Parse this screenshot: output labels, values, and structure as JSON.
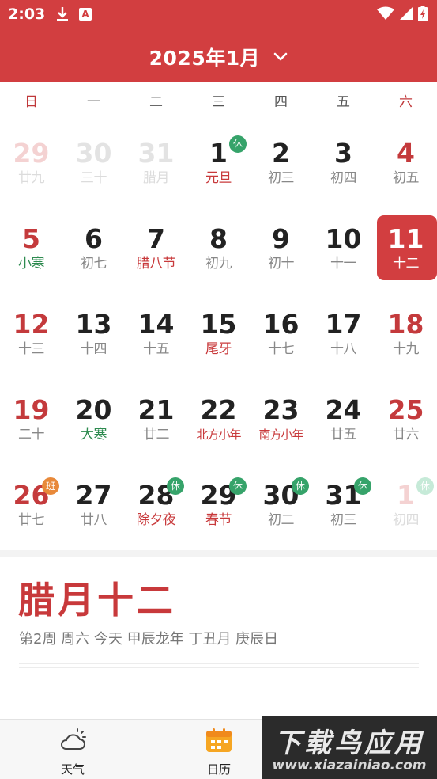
{
  "status_bar": {
    "time": "2:03",
    "notification_icons": [
      "download-icon",
      "a-app-icon"
    ],
    "system_icons": [
      "wifi-icon",
      "signal-icon",
      "battery-charging-icon"
    ]
  },
  "header": {
    "title": "2025年1月",
    "title_icon": "chevron-down-icon",
    "bg_color": "#d23e40"
  },
  "weekdays": [
    "日",
    "一",
    "二",
    "三",
    "四",
    "五",
    "六"
  ],
  "weeks": [
    [
      {
        "day": "29",
        "lunar": "廿九",
        "dim": true
      },
      {
        "day": "30",
        "lunar": "三十",
        "dim": true
      },
      {
        "day": "31",
        "lunar": "腊月",
        "dim": true
      },
      {
        "day": "1",
        "lunar": "元旦",
        "lunar_style": "fest",
        "badge": "休"
      },
      {
        "day": "2",
        "lunar": "初三"
      },
      {
        "day": "3",
        "lunar": "初四"
      },
      {
        "day": "4",
        "lunar": "初五"
      }
    ],
    [
      {
        "day": "5",
        "lunar": "小寒",
        "lunar_style": "term"
      },
      {
        "day": "6",
        "lunar": "初七"
      },
      {
        "day": "7",
        "lunar": "腊八节",
        "lunar_style": "fest"
      },
      {
        "day": "8",
        "lunar": "初九"
      },
      {
        "day": "9",
        "lunar": "初十"
      },
      {
        "day": "10",
        "lunar": "十一"
      },
      {
        "day": "11",
        "lunar": "十二",
        "selected": true
      }
    ],
    [
      {
        "day": "12",
        "lunar": "十三"
      },
      {
        "day": "13",
        "lunar": "十四"
      },
      {
        "day": "14",
        "lunar": "十五"
      },
      {
        "day": "15",
        "lunar": "尾牙",
        "lunar_style": "fest"
      },
      {
        "day": "16",
        "lunar": "十七"
      },
      {
        "day": "17",
        "lunar": "十八"
      },
      {
        "day": "18",
        "lunar": "十九"
      }
    ],
    [
      {
        "day": "19",
        "lunar": "二十"
      },
      {
        "day": "20",
        "lunar": "大寒",
        "lunar_style": "term"
      },
      {
        "day": "21",
        "lunar": "廿二"
      },
      {
        "day": "22",
        "lunar": "北方小年",
        "lunar_style": "fest"
      },
      {
        "day": "23",
        "lunar": "南方小年",
        "lunar_style": "fest"
      },
      {
        "day": "24",
        "lunar": "廿五"
      },
      {
        "day": "25",
        "lunar": "廿六"
      }
    ],
    [
      {
        "day": "26",
        "lunar": "廿七",
        "badge": "班",
        "badge_style": "work"
      },
      {
        "day": "27",
        "lunar": "廿八"
      },
      {
        "day": "28",
        "lunar": "除夕夜",
        "lunar_style": "fest",
        "badge": "休"
      },
      {
        "day": "29",
        "lunar": "春节",
        "lunar_style": "fest",
        "badge": "休"
      },
      {
        "day": "30",
        "lunar": "初二",
        "badge": "休"
      },
      {
        "day": "31",
        "lunar": "初三",
        "badge": "休"
      },
      {
        "day": "1",
        "lunar": "初四",
        "dim": true,
        "badge": "休"
      }
    ]
  ],
  "info": {
    "lunar_date": "腊月十二",
    "detail": "第2周 周六 今天 甲辰龙年 丁丑月 庚辰日"
  },
  "bottom_nav": [
    {
      "label": "天气",
      "icon": "cloud-weather-icon"
    },
    {
      "label": "日历",
      "icon": "calendar-icon",
      "active": true
    }
  ],
  "watermark": {
    "title": "下载鸟应用",
    "url": "www.xiazainiao.com"
  }
}
